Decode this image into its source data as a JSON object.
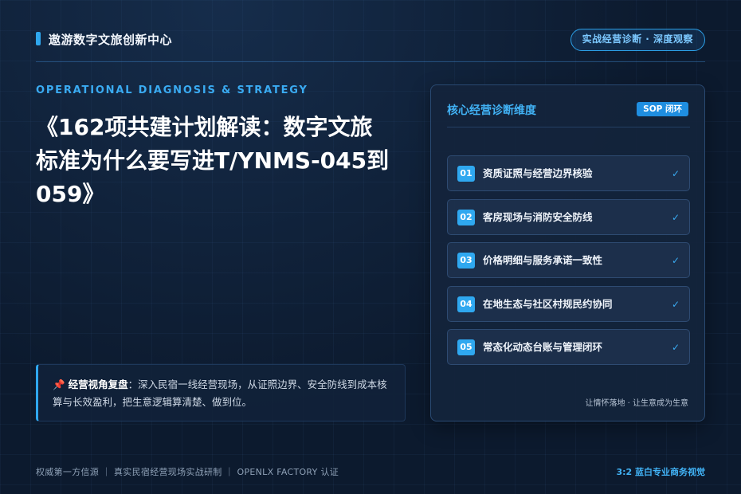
{
  "header": {
    "brand": "遨游数字文旅创新中心",
    "pill": "实战经营诊断 · 深度观察"
  },
  "hero": {
    "eyebrow": "OPERATIONAL DIAGNOSIS & STRATEGY",
    "title": "《162项共建计划解读：数字文旅标准为什么要写进T/YNMS-045到059》"
  },
  "quote": {
    "icon": "pushpin-icon",
    "label": "经营视角复盘",
    "colon": "：",
    "text": "深入民宿一线经营现场，从证照边界、安全防线到成本核算与长效盈利，把生意逻辑算清楚、做到位。"
  },
  "panel": {
    "title": "核心经营诊断维度",
    "badge": "SOP 闭环",
    "items": [
      {
        "num": "01",
        "label": "资质证照与经营边界核验",
        "check": "✓"
      },
      {
        "num": "02",
        "label": "客房现场与消防安全防线",
        "check": "✓"
      },
      {
        "num": "03",
        "label": "价格明细与服务承诺一致性",
        "check": "✓"
      },
      {
        "num": "04",
        "label": "在地生态与社区村规民约协同",
        "check": "✓"
      },
      {
        "num": "05",
        "label": "常态化动态台账与管理闭环",
        "check": "✓"
      }
    ],
    "footnote": "让情怀落地 · 让生意成为生意"
  },
  "footer": {
    "left": "权威第一方信源 ｜ 真实民宿经营现场实战研制 ｜ OPENLX FACTORY 认证",
    "right": "3:2 蓝白专业商务视觉"
  },
  "colors": {
    "accent": "#2fa8f0",
    "background": "#0c1a2e",
    "panel": "#14243c"
  }
}
